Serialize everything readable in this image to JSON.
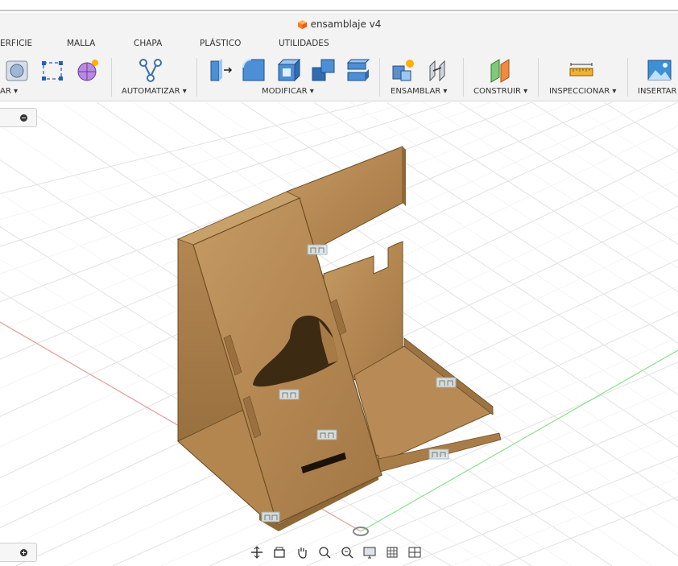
{
  "window": {
    "title": "ensamblaje v4"
  },
  "tabs": [
    {
      "label": "ERFICIE"
    },
    {
      "label": "MALLA"
    },
    {
      "label": "CHAPA"
    },
    {
      "label": "PLÁSTICO"
    },
    {
      "label": "UTILIDADES"
    }
  ],
  "toolbar": {
    "groups": [
      {
        "label": "AR ▾"
      },
      {
        "label": "AUTOMATIZAR ▾"
      },
      {
        "label": "MODIFICAR ▾"
      },
      {
        "label": "ENSAMBLAR ▾"
      },
      {
        "label": "CONSTRUIR ▾"
      },
      {
        "label": "INSPECCIONAR ▾"
      },
      {
        "label": "INSERTAR"
      }
    ]
  },
  "navbar": {
    "items": [
      "orbit-icon",
      "look-at-icon",
      "pan-icon",
      "zoom-icon",
      "fit-icon",
      "display-settings-icon",
      "grid-icon",
      "viewports-icon"
    ]
  },
  "colors": {
    "accent": "#ff8a1f",
    "wood": "#b58a52",
    "wood_dark": "#8b6637",
    "grid_line": "#dcdcdc",
    "axis_x": "#e15a5a",
    "axis_y": "#6ad46a"
  }
}
